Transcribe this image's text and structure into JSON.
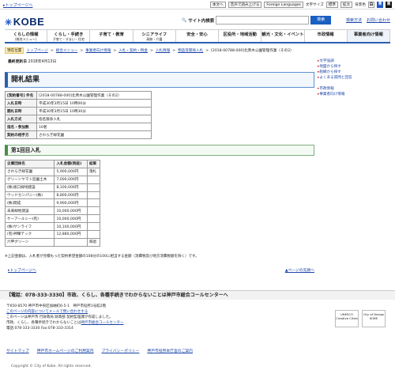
{
  "topbar": {
    "top_link": "▸トップページへ",
    "tools": [
      "本文へ",
      "音声で読み上げる",
      "Foreign Languages",
      "文字サイズ",
      "標準",
      "拡大",
      "背景色"
    ],
    "colors": [
      {
        "label": "白",
        "bg": "#ffffff",
        "fg": "#000000"
      },
      {
        "label": "青",
        "bg": "#1f56c9",
        "fg": "#ffffff"
      },
      {
        "label": "黒",
        "bg": "#111111",
        "fg": "#ffffff"
      }
    ]
  },
  "header": {
    "logo": "KOBE",
    "search_label": "サイト内検索",
    "search_button": "検索",
    "links": [
      "検索方法",
      "お問い合わせ"
    ]
  },
  "nav": [
    {
      "label": "くらしの情報",
      "sub": "(総合メニュー)"
    },
    {
      "label": "くらし・手続き",
      "sub": "子育て・すまい・住宅"
    },
    {
      "label": "子育て・教育",
      "sub": ""
    },
    {
      "label": "シニアライフ",
      "sub": "高齢・介護"
    },
    {
      "label": "安全・安心",
      "sub": ""
    },
    {
      "label": "区役所・地域活動",
      "sub": ""
    },
    {
      "label": "観光・文化・イベント",
      "sub": ""
    },
    {
      "label": "市政情報",
      "sub": ""
    },
    {
      "label": "事業者向け情報",
      "sub": ""
    }
  ],
  "breadcrumb": {
    "here": "現在位置",
    "items": [
      "トップページ",
      "総合メニュー",
      "事業者向け情報",
      "入札・契約・税金",
      "入札情報",
      "物品等関係入札",
      "[2018-00788-000]北青木公園管理作業（その2）"
    ]
  },
  "updated": {
    "label": "最終更新日",
    "date": "2018年4月13日"
  },
  "page_title": "開札結果",
  "sidebar": {
    "group1": [
      "文字強調",
      "地図から探す",
      "組織から探す",
      "よくある質問と回答"
    ],
    "group2": [
      "市政情報",
      "事業者向け情報"
    ]
  },
  "info_table": [
    {
      "k": "[契約番号] 件名",
      "v": "[2018-00788-000]北青木公園管理作業（その2）"
    },
    {
      "k": "入札日時",
      "v": "平成30年3月15日 10時00分"
    },
    {
      "k": "開札日時",
      "v": "平成30年3月15日 10時30分"
    },
    {
      "k": "入札方式",
      "v": "指名競争入札"
    },
    {
      "k": "指名・参加数",
      "v": "10者"
    },
    {
      "k": "契約の相手方",
      "v": "さわらぎ緑花園"
    }
  ],
  "section_title": "第1回目入札",
  "bids": {
    "headers": [
      "企業団体名",
      "入札金額(税抜)",
      "結果"
    ],
    "rows": [
      [
        "さわらぎ緑花園",
        "5,900,000円",
        "落札"
      ],
      [
        "グリーンヤマト造園土木",
        "7,000,000円",
        ""
      ],
      [
        "(株)坂口緑地建設",
        "8,100,000円",
        ""
      ],
      [
        "ウッドカンパニー(株)",
        "8,800,000円",
        ""
      ],
      [
        "(株)関成",
        "9,900,000円",
        ""
      ],
      [
        "未来緑地建設",
        "10,000,000円",
        ""
      ],
      [
        "ケーアールシー(有)",
        "10,000,000円",
        ""
      ],
      [
        "(株)サンライフ",
        "10,100,000円",
        ""
      ],
      [
        "(有)神輝テック",
        "12,880,000円",
        ""
      ],
      [
        "六甲グリーン",
        "",
        "辞退"
      ]
    ]
  },
  "note": "※上記金額は、入札者が見積もった契約希望金額の108分の100に相当する金額（消費税及び地方消費税額を除く）です。",
  "page_nav": {
    "top": "トップページへ",
    "up": "ページの先頭へ"
  },
  "footer": {
    "callcenter": "【電話：078-333-3330】市政、くらし、各種手続きでわからないことは神戸市総合コールセンターへ",
    "address": "〒650-8570 神戸市中央区加納町6-5-1　神戸市役所1号館2階",
    "contact_link": "このページの内容についてメールで問い合わせする",
    "page_info": "このページは神戸市 行財政局 財政部 契約監理課が作成しました。",
    "inquiry_text": "市政、くらし、各種手続きでわからないことは",
    "inquiry_link": "神戸市総合コールセンター",
    "phone": "電話:078-333-3330 Fax:078-333-3314",
    "badges": [
      "UNESCO Creative Cities",
      "City of Design KOBE"
    ],
    "links": [
      "サイトマップ",
      "神戸市ホームページのご利用案内",
      "プライバシーポリシー",
      "神戸市役所本庁舎のご案内"
    ],
    "copyright": "Copyright © City of Kobe. All rights reserved."
  }
}
